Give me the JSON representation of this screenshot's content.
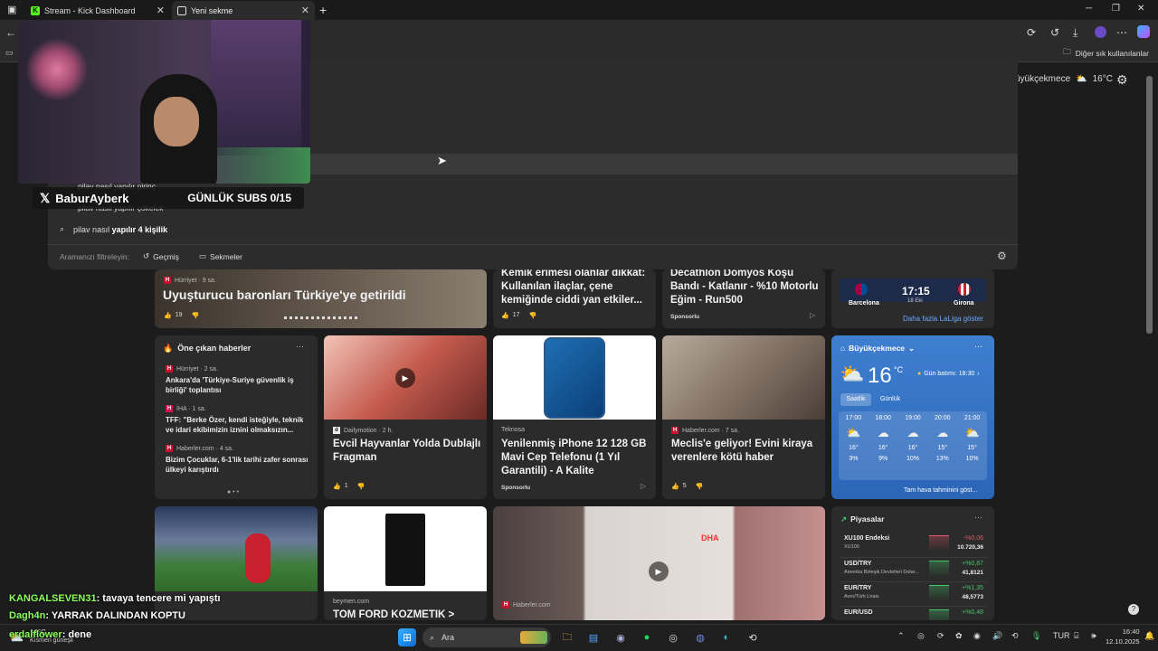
{
  "browser": {
    "tabs": [
      {
        "label": "Stream - Kick Dashboard"
      },
      {
        "label": "Yeni sekme"
      }
    ],
    "favorites_other": "Diğer sık kullanılanlar"
  },
  "weather_top": {
    "location": "üyükçekmece",
    "temp": "16°C"
  },
  "search_dropdown": {
    "partial_1": "pilav nasıl yapılır pirinç",
    "partial_2": "pilav nasıl yapılır çökelek",
    "suggestion_prefix": "pilav nasıl",
    "suggestion_bold": "yapılır 4 kişilik",
    "filter_label": "Aramanızı filtreleyin:",
    "filters": [
      "Geçmiş",
      "Sekmeler"
    ]
  },
  "stream_overlay": {
    "handle": "BaburAyberk",
    "subs": "GÜNLÜK SUBS 0/15"
  },
  "news_row1": [
    {
      "source": "Hürriyet · 9 sa.",
      "title": "Uyuşturucu baronları Türkiye'ye getirildi",
      "likes": "19"
    },
    {
      "title": "Kemik erimesi olanlar dikkat: Kullanılan ilaçlar, çene kemiğinde ciddi yan etkiler...",
      "likes": "17"
    },
    {
      "title": "Decathlon Domyos Koşu Bandı - Katlanır - %10 Motorlu Eğim - Run500",
      "sponsor": "Sponsorlu"
    }
  ],
  "sports": {
    "time": "17:15",
    "date": "18 Eki",
    "home": "Barcelona",
    "away": "Girona",
    "more": "Daha fazla LaLiga göster"
  },
  "top_stories": {
    "title": "Öne çıkan haberler",
    "items": [
      {
        "source": "Hürriyet · 2 sa.",
        "title": "Ankara'da 'Türkiye-Suriye güvenlik iş birliği' toplantısı"
      },
      {
        "source": "İHA · 1 sa.",
        "title": "TFF: \"Berke Özer, kendi isteğiyle, teknik ve idari ekibimizin iznini olmaksızın..."
      },
      {
        "source": "Haberler.com · 4 sa.",
        "title": "Bizim Çocuklar, 6-1'lik tarihi zafer sonrası ülkeyi karıştırdı"
      }
    ]
  },
  "news_row2": [
    {
      "source": "Dailymotion · 2 h.",
      "title": "Evcil Hayvanlar Yolda Dublajlı Fragman",
      "likes": "1"
    },
    {
      "source": "Teknosa",
      "title": "Yenilenmiş iPhone 12 128 GB Mavi Cep Telefonu (1 Yıl Garantili) - A Kalite",
      "sponsor": "Sponsorlu"
    },
    {
      "source": "Haberler.com · 7 sa.",
      "title": "Meclis'e geliyor! Evini kiraya verenlere kötü haber",
      "likes": "5"
    }
  ],
  "weather": {
    "location": "Büyükçekmece",
    "temp": "16",
    "unit": "°C",
    "sunset": "Gün batımı: 18:30",
    "tabs": [
      "Saatlik",
      "Günlük"
    ],
    "hours": [
      {
        "time": "17:00",
        "temp": "16°",
        "rain": "3%"
      },
      {
        "time": "18:00",
        "temp": "16°",
        "rain": "9%"
      },
      {
        "time": "19:00",
        "temp": "16°",
        "rain": "10%"
      },
      {
        "time": "20:00",
        "temp": "15°",
        "rain": "13%"
      },
      {
        "time": "21:00",
        "temp": "15°",
        "rain": "10%"
      }
    ],
    "more": "Tam hava tahminini göst..."
  },
  "markets": {
    "title": "Piyasalar",
    "rows": [
      {
        "name": "XU100 Endeksi",
        "sub": "XU100",
        "change": "-%0,06",
        "value": "10.720,36",
        "color": "#e05a6a"
      },
      {
        "name": "USD/TRY",
        "sub": "Amerika Birleşik Devletleri Dolar...",
        "change": "+%0,87",
        "value": "41,8121",
        "color": "#45c46a"
      },
      {
        "name": "EUR/TRY",
        "sub": "Avro/Türk Lirası",
        "change": "+%1,35",
        "value": "48,5773",
        "color": "#45c46a"
      },
      {
        "name": "EUR/USD",
        "sub": "",
        "change": "+%0,48",
        "value": "",
        "color": "#45c46a"
      }
    ]
  },
  "news_row3": [
    {
      "source": "beymen.com",
      "title": "TOM FORD KOZMETIK >"
    },
    {
      "source": "Haberler.com"
    }
  ],
  "chat": [
    {
      "user": "KANGALSEVEN31",
      "msg": ": tavaya tencere mi yapıştı"
    },
    {
      "user": "Dagh4n",
      "msg": ": YARRAK DALINDAN KOPTU"
    },
    {
      "user": "erdalflower",
      "msg": ": dene"
    }
  ],
  "taskbar": {
    "search": "Ara",
    "weather_temp": "16°C",
    "weather_text": "Kısmen güneşli",
    "lang": "TUR",
    "time": "16:40",
    "date": "12.10.2025"
  }
}
